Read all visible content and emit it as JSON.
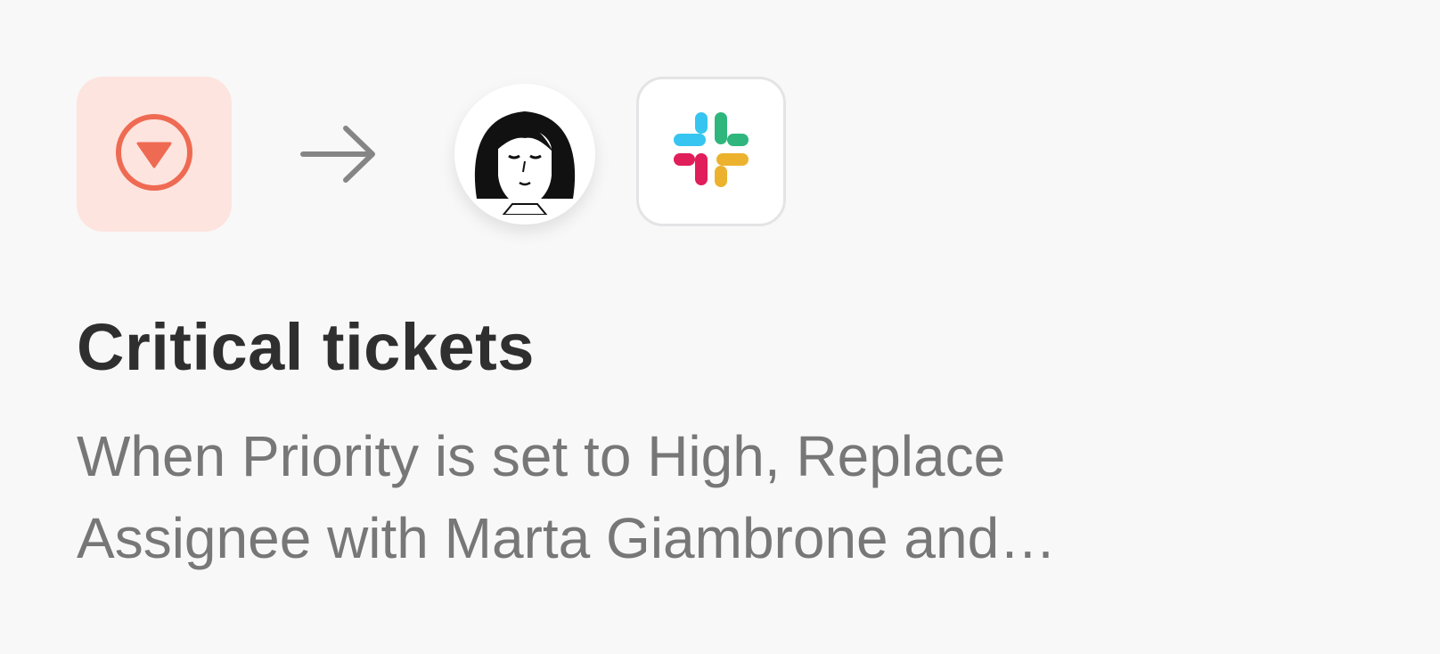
{
  "rule_card": {
    "trigger_icon": "priority-down-circle-icon",
    "trigger_color": "#ef6a52",
    "trigger_bg": "#fde4df",
    "arrow_icon": "arrow-right-icon",
    "assignee_avatar": "avatar-icon",
    "integration_icon": "slack-logo-icon",
    "title": "Critical tickets",
    "description": "When Priority is set to High, Replace Assignee with Marta Giambrone and…"
  }
}
